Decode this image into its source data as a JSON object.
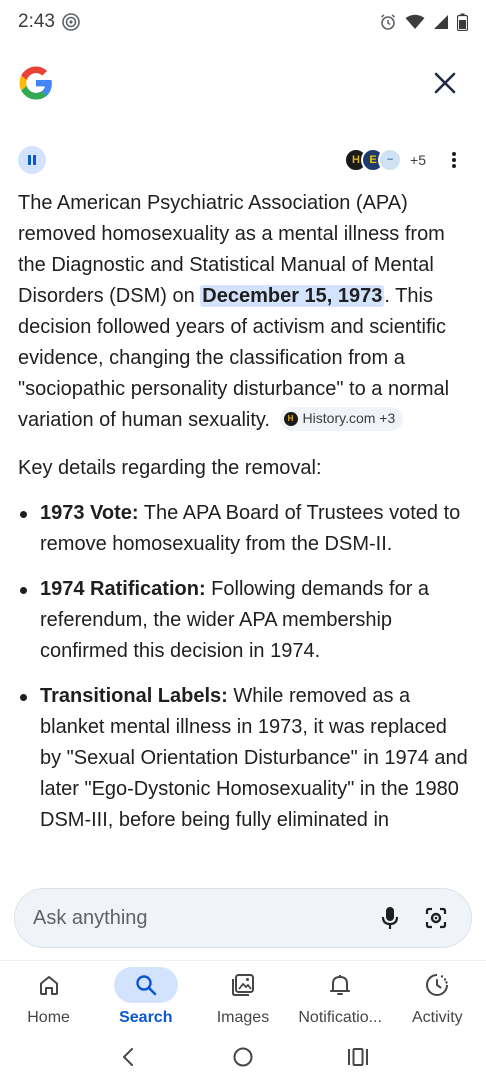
{
  "status_bar": {
    "time": "2:43"
  },
  "header": {
    "logo_icon": "google-g-logo",
    "close_icon": "close-icon"
  },
  "overview": {
    "sources": [
      {
        "name": "History.com",
        "glyph": "H"
      },
      {
        "name": "Encyclopedia",
        "glyph": "E"
      },
      {
        "name": "Web source",
        "glyph": "~"
      }
    ],
    "more_sources": "+5",
    "paragraph": {
      "part1": "The American Psychiatric Association (APA) removed homosexuality as a mental illness from the Diagnostic and Statistical Manual of Mental Disorders (DSM) on ",
      "highlight": "December 15, 1973",
      "part2": ". This decision followed years of activism and scientific evidence, changing the classification from a \"sociopathic personality disturbance\" to a normal variation of human sexuality.",
      "citation": "History.com +3"
    },
    "key_heading": "Key details regarding the removal:",
    "bullets": [
      {
        "term": "1973 Vote:",
        "text": " The APA Board of Trustees voted to remove homosexuality from the DSM-II."
      },
      {
        "term": "1974 Ratification:",
        "text": " Following demands for a referendum, the wider APA membership confirmed this decision in 1974."
      },
      {
        "term": "Transitional Labels:",
        "text": " While removed as a blanket mental illness in 1973, it was replaced by \"Sexual Orientation Disturbance\" in 1974 and later \"Ego-Dystonic Homosexuality\" in the 1980 DSM-III, before being fully eliminated in"
      }
    ]
  },
  "ask_bar": {
    "placeholder": "Ask anything",
    "mic_icon": "microphone-icon",
    "lens_icon": "lens-camera-icon"
  },
  "bottom_nav": {
    "items": [
      {
        "label": "Home",
        "icon": "home-icon",
        "active": false
      },
      {
        "label": "Search",
        "icon": "search-icon",
        "active": true
      },
      {
        "label": "Images",
        "icon": "images-icon",
        "active": false
      },
      {
        "label": "Notificatio...",
        "icon": "bell-icon",
        "active": false
      },
      {
        "label": "Activity",
        "icon": "activity-icon",
        "active": false
      }
    ]
  },
  "colors": {
    "accent": "#0b57d0",
    "highlight_bg": "#d3e3fd",
    "text": "#1f1f1f"
  }
}
